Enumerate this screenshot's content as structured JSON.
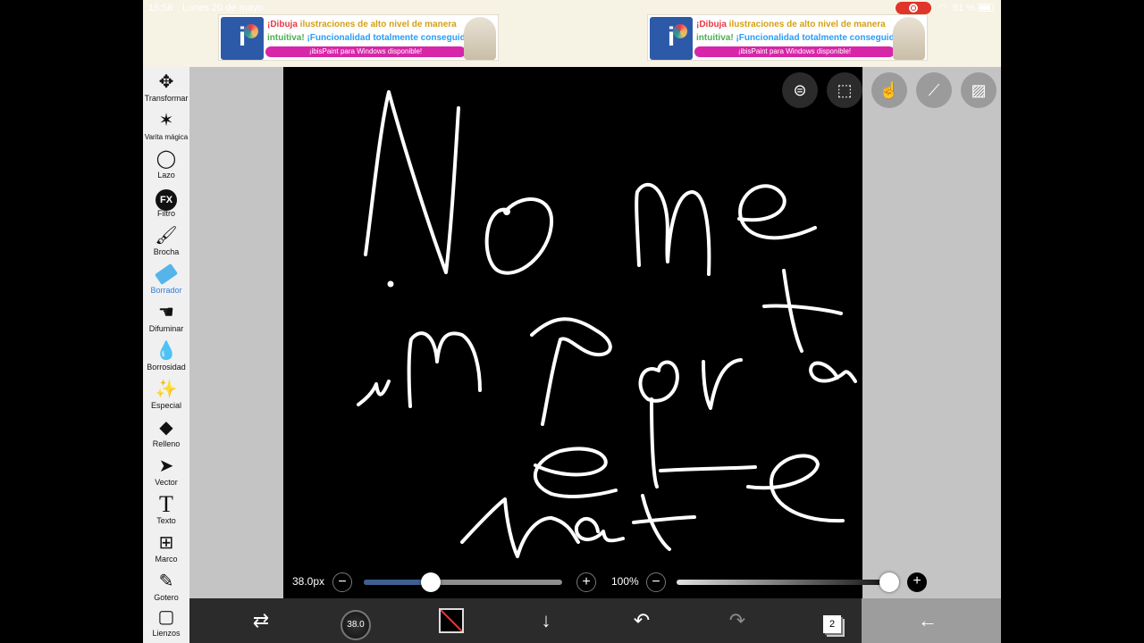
{
  "status": {
    "time": "15:56",
    "date": "Lunes 20 de mayo",
    "battery": "81 %"
  },
  "ads": [
    {
      "line1_a": "¡Dibuja ",
      "line1_b": "ilustraciones de alto nivel de manera",
      "line2_a": "intuitiva! ",
      "line2_b": "¡Funcionalidad totalmente conseguida!",
      "cta": "¡ibisPaint para Windows disponible!"
    },
    {
      "line1_a": "¡Dibuja ",
      "line1_b": "ilustraciones de alto nivel de manera",
      "line2_a": "intuitiva! ",
      "line2_b": "¡Funcionalidad totalmente conseguida!",
      "cta": "¡ibisPaint para Windows disponible!"
    }
  ],
  "tools": [
    {
      "label": "Transformar",
      "icon": "move-icon"
    },
    {
      "label": "Varita mágica",
      "icon": "magic-wand-icon"
    },
    {
      "label": "Lazo",
      "icon": "lasso-icon"
    },
    {
      "label": "Filtro",
      "icon": "fx-icon",
      "glyph": "FX"
    },
    {
      "label": "Brocha",
      "icon": "brush-icon"
    },
    {
      "label": "Borrador",
      "icon": "eraser-icon",
      "active": true
    },
    {
      "label": "Difuminar",
      "icon": "smudge-icon"
    },
    {
      "label": "Borrosidad",
      "icon": "blur-drop-icon"
    },
    {
      "label": "Especial",
      "icon": "sparkle-icon"
    },
    {
      "label": "Relleno",
      "icon": "fill-icon"
    },
    {
      "label": "Vector",
      "icon": "cursor-icon"
    },
    {
      "label": "Texto",
      "icon": "text-icon",
      "glyph": "T"
    },
    {
      "label": "Marco",
      "icon": "frame-icon"
    },
    {
      "label": "Gotero",
      "icon": "eyedropper-icon"
    },
    {
      "label": "Lienzos",
      "icon": "canvas-icon"
    }
  ],
  "canvas_controls": {
    "brush_size": "38.0px",
    "brush_size_fraction": 0.34,
    "opacity": "100%",
    "opacity_fraction": 1.0
  },
  "bottom": {
    "brush_size_value": "38.0",
    "layer_count": "2"
  },
  "colors": {
    "accent": "#2f7fd8",
    "record": "#e0352b",
    "ad_cta": "#d726a8"
  }
}
